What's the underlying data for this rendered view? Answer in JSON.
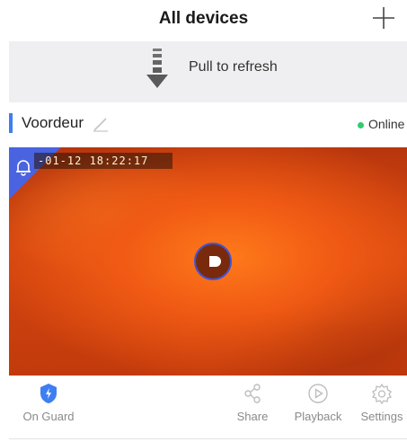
{
  "header": {
    "title": "All devices"
  },
  "refresh": {
    "text": "Pull to refresh"
  },
  "device": {
    "name": "Voordeur",
    "status": "Online",
    "timestamp": "-01-12  18:22:17",
    "accent_color": "#3d7ff2",
    "status_color": "#2ecc71"
  },
  "actions": {
    "guard": "On Guard",
    "share": "Share",
    "playback": "Playback",
    "settings": "Settings"
  },
  "icons": [
    "plus-icon",
    "down-arrow-icon",
    "pencil-icon",
    "bell-icon",
    "play-icon",
    "shield-icon",
    "share-icon",
    "playback-icon",
    "gear-icon"
  ]
}
